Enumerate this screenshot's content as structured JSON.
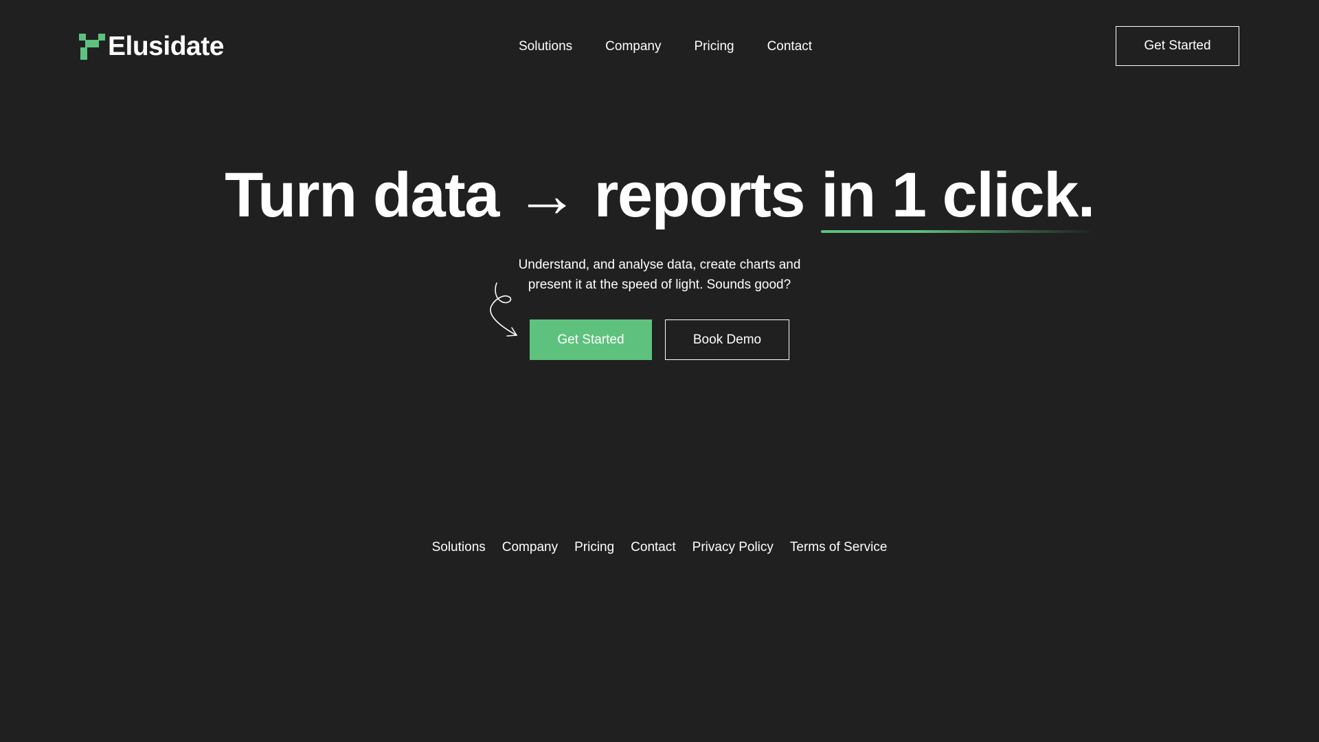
{
  "brand": {
    "name": "Elusidate",
    "logo_icon": "pixel-logo-icon",
    "accent_color": "#5ec27e"
  },
  "nav": {
    "items": [
      {
        "label": "Solutions"
      },
      {
        "label": "Company"
      },
      {
        "label": "Pricing"
      },
      {
        "label": "Contact"
      }
    ],
    "cta_label": "Get Started"
  },
  "hero": {
    "title_main": "Turn data → reports ",
    "title_highlight": "in 1 click.",
    "subtitle_line1": "Understand, and analyse data, create charts and",
    "subtitle_line2": "present it at the speed of light. Sounds good?",
    "doodle_icon": "curly-arrow-icon",
    "primary_label": "Get Started",
    "secondary_label": "Book Demo"
  },
  "footer": {
    "links": [
      {
        "label": "Solutions"
      },
      {
        "label": "Company"
      },
      {
        "label": "Pricing"
      },
      {
        "label": "Contact"
      },
      {
        "label": "Privacy Policy"
      },
      {
        "label": "Terms of Service"
      }
    ]
  },
  "colors": {
    "background": "#202020",
    "text": "#ffffff",
    "primary_button": "#5ec27e"
  }
}
